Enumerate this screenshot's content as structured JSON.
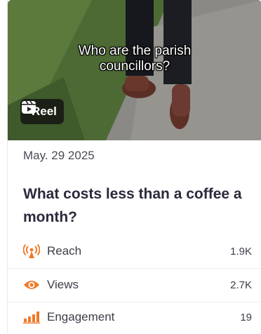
{
  "post": {
    "media": {
      "caption_lines": [
        "Who are the parish",
        "councillors?"
      ],
      "type_label": "Reel",
      "type_icon": "reel-icon"
    },
    "date": "May. 29 2025",
    "title": "What costs less than a coffee a month?",
    "metrics": [
      {
        "label": "Reach",
        "value": "1.9K",
        "icon": "reach-icon",
        "color": "#f07a2a"
      },
      {
        "label": "Views",
        "value": "2.7K",
        "icon": "eye-icon",
        "color": "#f07a2a"
      },
      {
        "label": "Engagement",
        "value": "19",
        "icon": "bar-chart-icon",
        "color": "#f07a2a"
      }
    ]
  }
}
